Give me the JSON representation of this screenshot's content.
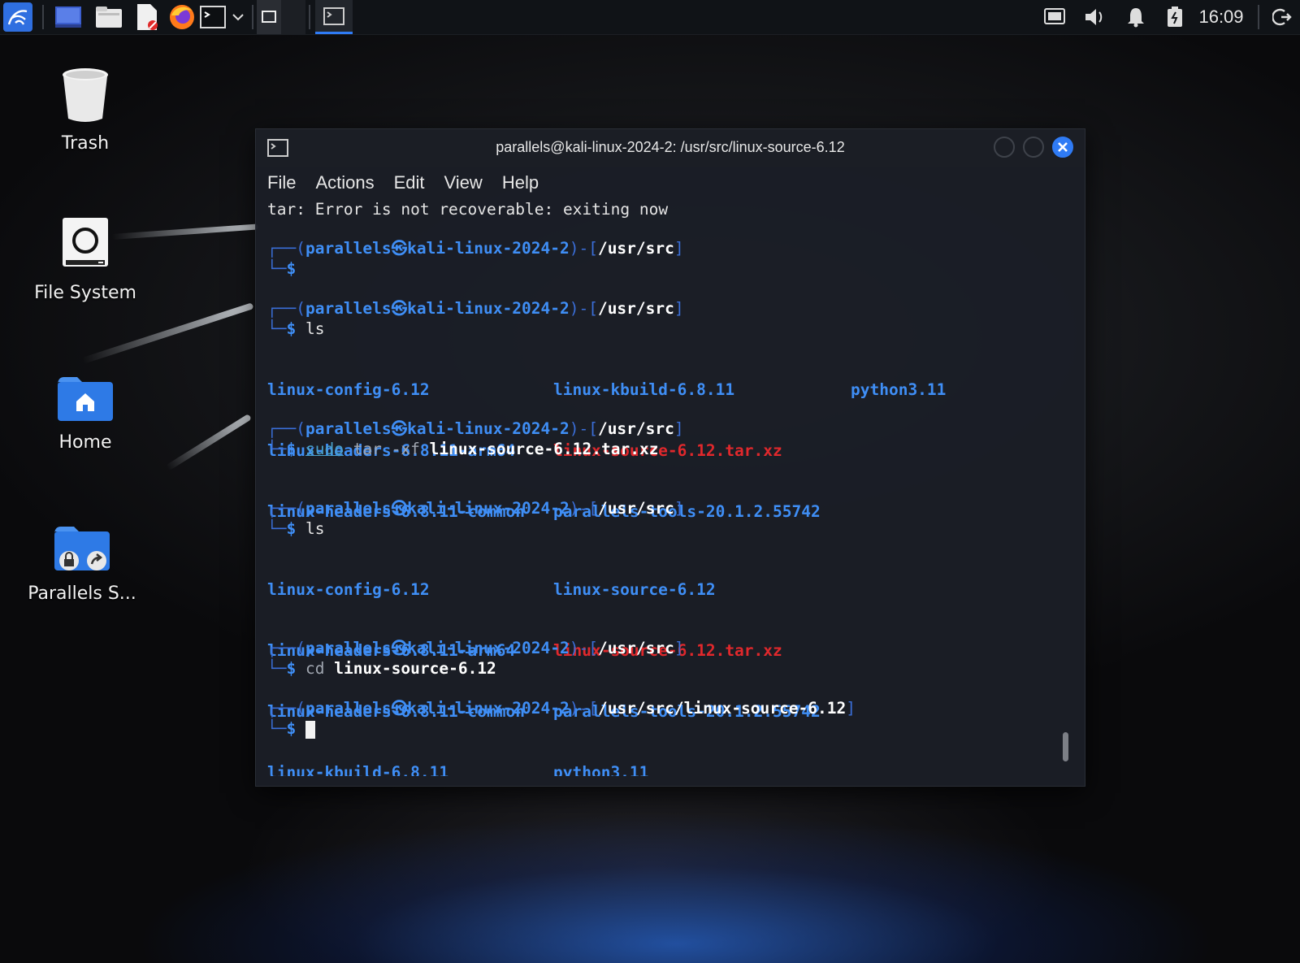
{
  "panel": {
    "clock": "16:09",
    "icons": [
      "kali-menu-icon",
      "workspace-icon",
      "file-manager-icon",
      "text-editor-icon",
      "firefox-icon",
      "terminal-icon",
      "dropdown-icon",
      "workspace1-icon",
      "workspace2-icon",
      "terminal-task-icon",
      "display-icon",
      "volume-icon",
      "notification-icon",
      "battery-icon",
      "logout-icon"
    ]
  },
  "desktop": {
    "icons": [
      {
        "label": "Trash"
      },
      {
        "label": "File System"
      },
      {
        "label": "Home"
      },
      {
        "label": "Parallels S..."
      }
    ]
  },
  "window": {
    "title": "parallels@kali-linux-2024-2: /usr/src/linux-source-6.12",
    "menu": [
      "File",
      "Actions",
      "Edit",
      "View",
      "Help"
    ]
  },
  "terminal": {
    "error": "tar: Error is not recoverable: exiting now",
    "user": "parallels㉿kali-linux-2024-2",
    "path1": "/usr/src",
    "path2": "/usr/src/linux-source-6.12",
    "cmd_ls": "ls",
    "cmd_sudo": "sudo",
    "cmd_tar": "tar",
    "cmd_flag": "-xf",
    "cmd_tar_file": "linux-source-6.12.tar.xz",
    "cmd_cd": "cd",
    "cmd_cd_dir": "linux-source-6.12",
    "ls1": {
      "c1": [
        "linux-config-6.12",
        "linux-headers-6.8.11-arm64",
        "linux-headers-6.8.11-common"
      ],
      "c2": [
        "linux-kbuild-6.8.11",
        "linux-source-6.12.tar.xz",
        "parallels-tools-20.1.2.55742"
      ],
      "c3": [
        "python3.11"
      ]
    },
    "ls2": {
      "c1": [
        "linux-config-6.12",
        "linux-headers-6.8.11-arm64",
        "linux-headers-6.8.11-common",
        "linux-kbuild-6.8.11"
      ],
      "c2": [
        "linux-source-6.12",
        "linux-source-6.12.tar.xz",
        "parallels-tools-20.1.2.55742",
        "python3.11"
      ]
    },
    "colors": {
      "dir": "#3f8ef5",
      "archive": "#e0282c",
      "prompt": "#3a6ed8"
    }
  }
}
